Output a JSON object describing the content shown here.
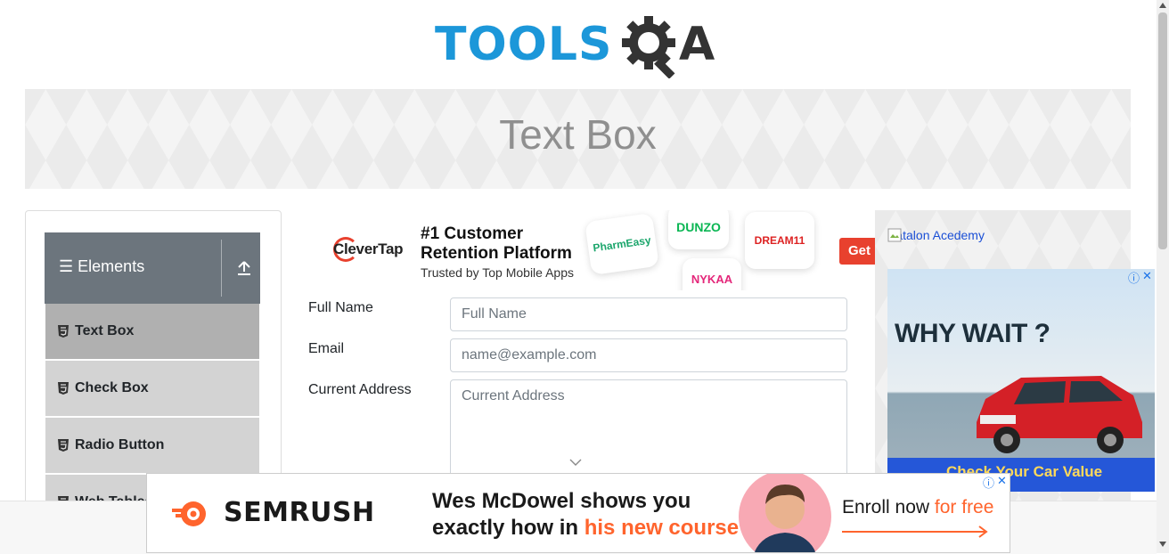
{
  "header": {
    "logo_text": "TOOLS",
    "logo_tail": "A"
  },
  "banner": {
    "title": "Text Box"
  },
  "sidebar": {
    "group_title": "Elements",
    "items": [
      {
        "label": "Text Box",
        "active": true
      },
      {
        "label": "Check Box",
        "active": false
      },
      {
        "label": "Radio Button",
        "active": false
      },
      {
        "label": "Web Tables",
        "active": false
      }
    ]
  },
  "ad_center": {
    "brand": "CleverTap",
    "headline_1": "#1 Customer",
    "headline_2": "Retention Platform",
    "subline": "Trusted by Top Mobile Apps",
    "tiles": [
      "PharmEasy",
      "DUNZO",
      "DREAM11",
      "NYKAA"
    ],
    "cta": "Get"
  },
  "form": {
    "full_name": {
      "label": "Full Name",
      "placeholder": "Full Name",
      "value": ""
    },
    "email": {
      "label": "Email",
      "placeholder": "name@example.com",
      "value": ""
    },
    "current_address": {
      "label": "Current Address",
      "placeholder": "Current Address",
      "value": ""
    }
  },
  "ad_right": {
    "image_alt": "Katalon Acedemy",
    "car_headline": "WHY WAIT ?",
    "car_cta": "Check Your Car Value",
    "adchoices": "ⓘ",
    "close": "✕"
  },
  "ad_bottom": {
    "brand": "SEMRUSH",
    "headline_line1": "Wes McDowel shows you",
    "headline_line2_a": "exactly how in ",
    "headline_line2_b": "his new course",
    "enroll_a": "Enroll now ",
    "enroll_b": "for free",
    "adchoices": "ⓘ",
    "close": "✕"
  },
  "colors": {
    "brand_blue": "#1C97D9",
    "sidebar_header": "#6c757d",
    "menu_bg": "#d3d3d3",
    "menu_active": "#b0b0b0",
    "clevertap_red": "#e8412e",
    "semrush_orange": "#ff642d"
  }
}
